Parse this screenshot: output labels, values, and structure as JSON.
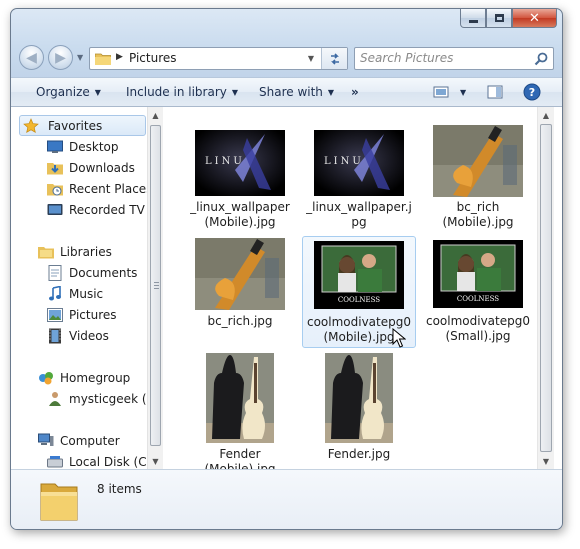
{
  "window": {
    "address_path": "Pictures",
    "search_placeholder": "Search Pictures"
  },
  "toolbar": {
    "organize": "Organize",
    "include": "Include in library",
    "share": "Share with",
    "more": "»"
  },
  "nav_pane": {
    "favorites_header": "Favorites",
    "favorites": [
      "Desktop",
      "Downloads",
      "Recent Places",
      "Recorded TV"
    ],
    "libraries_header": "Libraries",
    "libraries": [
      "Documents",
      "Music",
      "Pictures",
      "Videos"
    ],
    "homegroup_header": "Homegroup",
    "homegroup_user": "mysticgeek (M",
    "computer_header": "Computer",
    "computer_drive": "Local Disk (C:)"
  },
  "files": [
    {
      "name": "_linux_wallpaper\n(Mobile).jpg",
      "kind": "linux"
    },
    {
      "name": "_linux_wallpaper.j\npg",
      "kind": "linux"
    },
    {
      "name": "bc_rich\n(Mobile).jpg",
      "kind": "guitar"
    },
    {
      "name": "bc_rich.jpg",
      "kind": "guitar"
    },
    {
      "name": "coolmodivatepg0\n(Mobile).jpg",
      "kind": "motivational",
      "selected": true
    },
    {
      "name": "coolmodivatepg0\n(Small).jpg",
      "kind": "motivational"
    },
    {
      "name": "Fender\n(Mobile).jpg",
      "kind": "fender"
    },
    {
      "name": "Fender.jpg",
      "kind": "fender"
    }
  ],
  "thumb_text": {
    "linux": "LINU",
    "motivational": "COOLNESS"
  },
  "status": {
    "item_count": "8 items"
  },
  "colors": {
    "accent": "#3d6aa3",
    "selection_border": "#a7cdf0",
    "close_button": "#c23a23"
  }
}
